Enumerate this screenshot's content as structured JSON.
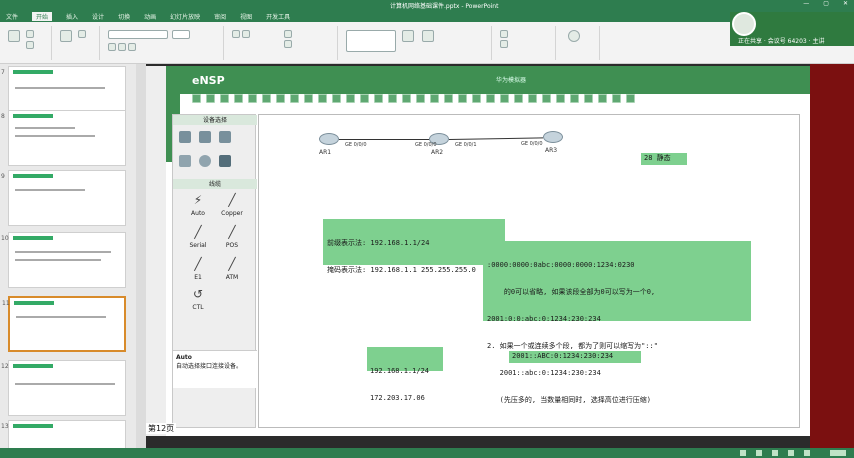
{
  "window": {
    "title": "计算机网络基础课件.pptx - PowerPoint",
    "controls": [
      "—",
      "▢",
      "✕"
    ]
  },
  "ribbon_tabs": [
    "文件",
    "开始",
    "插入",
    "设计",
    "切换",
    "动画",
    "幻灯片放映",
    "审阅",
    "视图",
    "开发工具"
  ],
  "meeting": {
    "caption": "正在共享 · 会议号 64203 · 主讲"
  },
  "sidebar": {
    "slide_numbers": [
      "7",
      "8",
      "9",
      "10",
      "11",
      "12",
      "13"
    ]
  },
  "ensp": {
    "app_name": "eNSP",
    "window_title": "华为模拟器",
    "device_panel_title": "设备选择",
    "cable_panel_title": "线缆",
    "cables": [
      "Auto",
      "Copper",
      "Serial",
      "POS",
      "E1",
      "ATM",
      "CTL"
    ],
    "auto_title": "Auto",
    "auto_desc": "自动选择接口连接设备。",
    "topology": {
      "routers": [
        "AR1",
        "AR2",
        "AR3"
      ],
      "link_labels": [
        "GE 0/0/0",
        "GE 0/0/0",
        "GE 0/0/1",
        "GE 0/0/0"
      ]
    }
  },
  "notes": {
    "tag": "28 静态",
    "mask_box": [
      "前缀表示法: 192.168.1.1/24",
      "掩码表示法: 192.168.1.1 255.255.255.0"
    ],
    "ipv6_box": [
      ":0000:0000:0abc:0000:0000:1234:0230",
      "    的0可以省略, 如果该段全部为0可以写为一个0,",
      "2001:0:0:abc:0:1234:230:234",
      "2. 如果一个或连续多个段, 都为了则可以缩写为\"::\"",
      "   2001::abc:0:1234:230:234",
      "   (先压多的, 当数量相同时, 选择高位进行压缩)"
    ],
    "ipv4_box": [
      "192.168.1.1/24",
      "172.203.17.06"
    ],
    "ipv6_short": "2001::ABC:0:1234:230:234"
  },
  "status": {
    "slide_label": "第12页"
  }
}
